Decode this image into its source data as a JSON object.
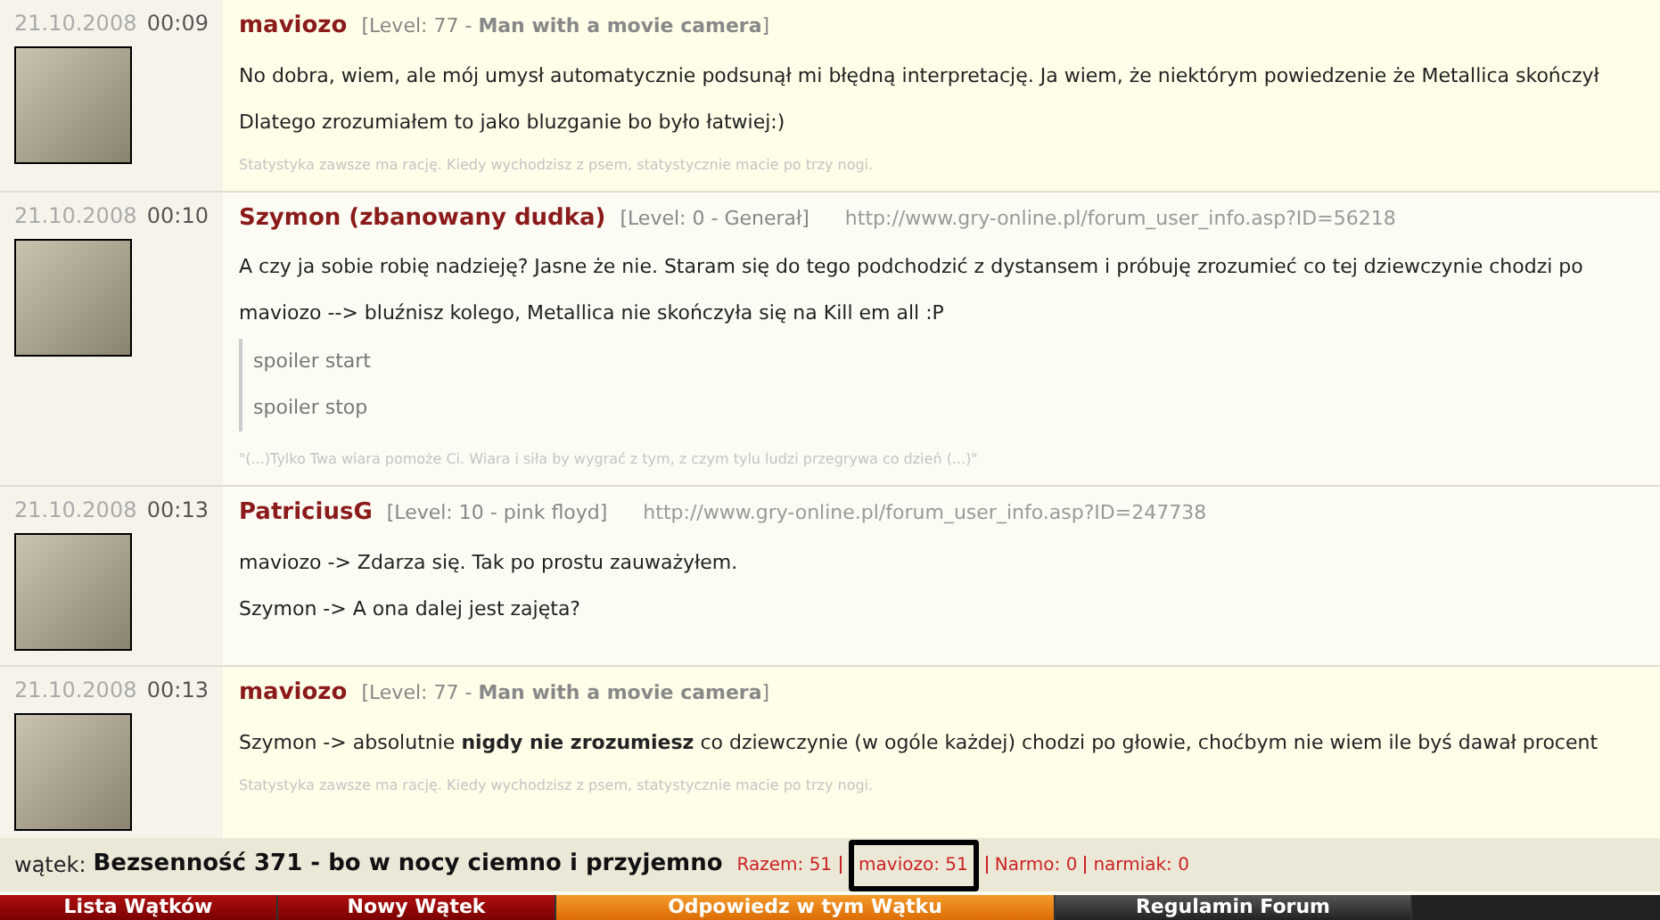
{
  "posts": [
    {
      "date": "21.10.2008",
      "time": "00:09",
      "author": "maviozo",
      "level": "[Level: 77 - **Man with a movie camera**]",
      "highlighted": true,
      "paragraphs": [
        "No dobra, wiem, ale mój umysł automatycznie podsunął mi błędną interpretację. Ja wiem, że niektórym powiedzenie że Metallica skończył",
        "Dlatego zrozumiałem to jako bluzganie bo było łatwiej:)"
      ],
      "signature": "Statystyka zawsze ma rację. Kiedy wychodzisz z psem, statystycznie macie po trzy nogi."
    },
    {
      "date": "21.10.2008",
      "time": "00:10",
      "author": "Szymon (zbanowany dudka)",
      "level": "[Level: 0 - Generał]",
      "profile_url": "http://www.gry-online.pl/forum_user_info.asp?ID=56218",
      "highlighted": false,
      "paragraphs": [
        "A czy ja sobie robię nadzieję? Jasne że nie. Staram się do tego podchodzić z dystansem i próbuję zrozumieć co tej dziewczynie chodzi po",
        "maviozo --> bluźnisz kolego, Metallica nie skończyła się na Kill em all :P"
      ],
      "spoiler": [
        "spoiler start",
        "spoiler stop"
      ],
      "signature": "\"(...)Tylko Twa wiara pomoże Ci. Wiara i siła by wygrać z tym, z czym tylu ludzi przegrywa co dzień (...)\""
    },
    {
      "date": "21.10.2008",
      "time": "00:13",
      "author": "PatriciusG",
      "level": "[Level: 10 - pink floyd]",
      "profile_url": "http://www.gry-online.pl/forum_user_info.asp?ID=247738",
      "highlighted": false,
      "paragraphs": [
        "maviozo -> Zdarza się. Tak po prostu zauważyłem.",
        "Szymon -> A ona dalej jest zajęta?"
      ]
    },
    {
      "date": "21.10.2008",
      "time": "00:13",
      "author": "maviozo",
      "level": "[Level: 77 - **Man with a movie camera**]",
      "highlighted": true,
      "paragraphs": [
        "Szymon -> absolutnie **nigdy nie zrozumiesz** co dziewczynie (w ogóle każdej) chodzi po głowie, choćbym nie wiem ile byś dawał procent"
      ],
      "signature": "Statystyka zawsze ma rację. Kiedy wychodzisz z psem, statystycznie macie po trzy nogi."
    }
  ],
  "thread": {
    "label": "wątek:",
    "title": "Bezsenność 371 - bo w nocy ciemno i przyjemno",
    "stats": [
      {
        "text": "Razem: 51",
        "circled": false
      },
      {
        "text": "maviozo: 51",
        "circled": true
      },
      {
        "text": "Narmo: 0",
        "circled": false
      },
      {
        "text": "narmiak: 0",
        "circled": false
      }
    ]
  },
  "nav": [
    {
      "label": "Lista Wątków",
      "kind": "red"
    },
    {
      "label": "Nowy Wątek",
      "kind": "red"
    },
    {
      "label": "Odpowiedz w tym Wątku",
      "kind": "orange"
    },
    {
      "label": "Regulamin Forum",
      "kind": "dark"
    }
  ]
}
